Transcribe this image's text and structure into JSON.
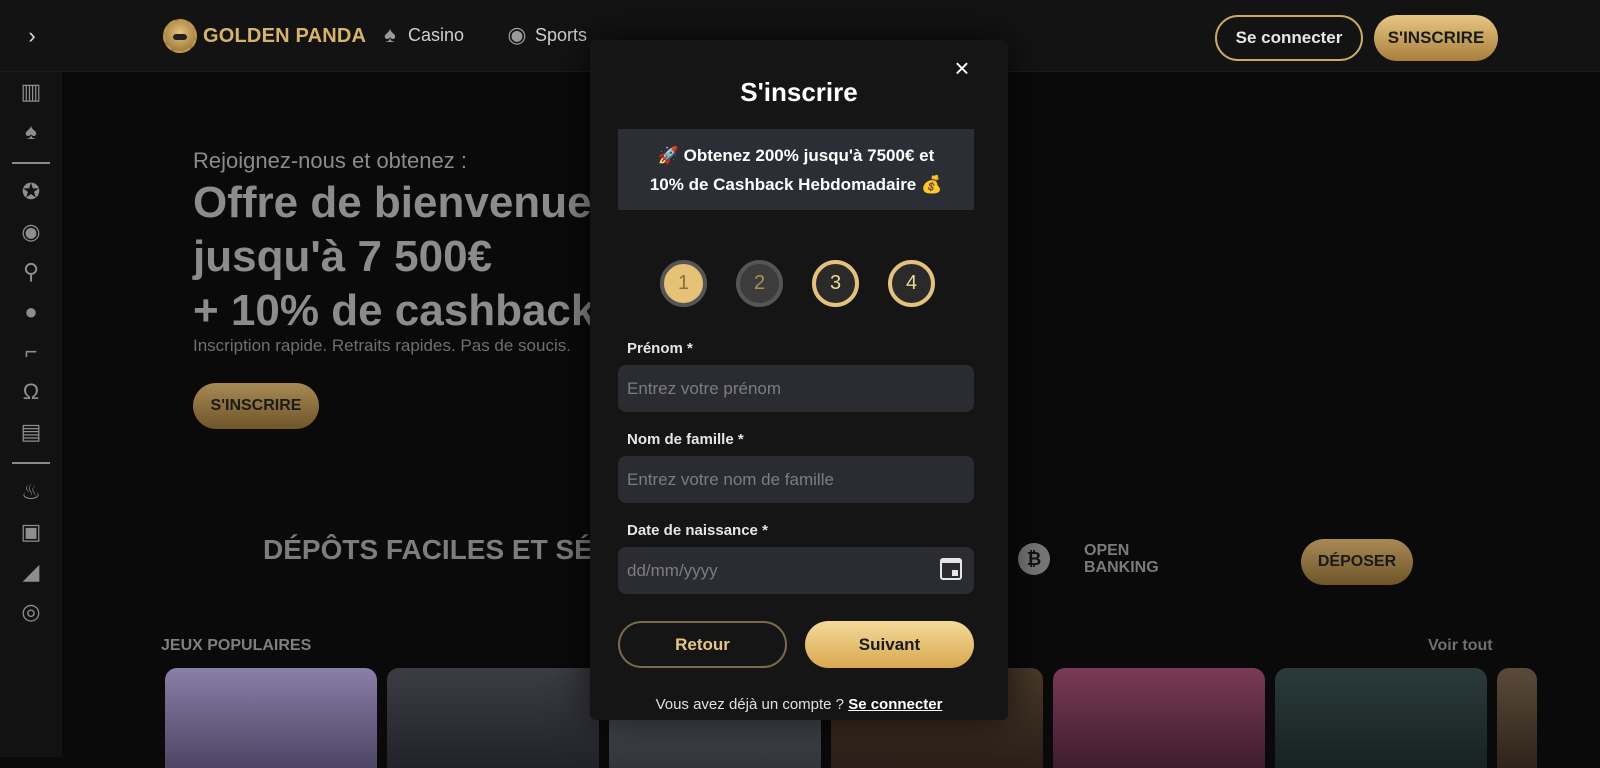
{
  "header": {
    "brand": "GOLDEN PANDA",
    "nav": [
      {
        "label": "Casino",
        "icon": "spade-icon"
      },
      {
        "label": "Sports",
        "icon": "soccer-ball-icon"
      }
    ],
    "login_label": "Se connecter",
    "signup_label": "S'INSCRIRE",
    "expand_icon": "›"
  },
  "sidebar": {
    "icons": [
      "slot-machine-icon",
      "card-icon",
      "star-badge-icon",
      "live-icon",
      "tennis-icon",
      "basketball-icon",
      "hockey-icon",
      "horseshoe-icon",
      "casino-building-icon",
      "fire-icon",
      "gift-icon",
      "megaphone-icon",
      "whistle-icon"
    ]
  },
  "hero": {
    "kicker": "Rejoignez-nous et obtenez :",
    "title_line1": "Offre de bienvenue",
    "title_line2": "jusqu'à 7 500€",
    "title_line3": "+ 10% de cashback",
    "subtitle": "Inscription rapide. Retraits rapides. Pas de soucis.",
    "cta": "S'INSCRIRE"
  },
  "deposit": {
    "title": "DÉPÔTS FACILES ET SÉC",
    "bitcoin_glyph": "₿",
    "open_banking_line1": "OPEN",
    "open_banking_line2": "BANKING",
    "button": "DÉPOSER"
  },
  "games": {
    "label": "JEUX POPULAIRES",
    "see_all": "Voir tout"
  },
  "modal": {
    "title": "S'inscrire",
    "close": "×",
    "promo_line1": "🚀 Obtenez 200% jusqu'à 7500€ et",
    "promo_line2": "10% de Cashback Hebdomadaire 💰",
    "steps": [
      "1",
      "2",
      "3",
      "4"
    ],
    "first_name_label": "Prénom",
    "first_name_placeholder": "Entrez votre prénom",
    "last_name_label": "Nom de famille",
    "last_name_placeholder": "Entrez votre nom de famille",
    "dob_label": "Date de naissance",
    "dob_placeholder": "dd/mm/yyyy",
    "required_mark": "*",
    "back_label": "Retour",
    "next_label": "Suivant",
    "footer_text": "Vous avez déjà un compte ?",
    "footer_link": "Se connecter"
  },
  "colors": {
    "gold": "#e3c27d",
    "background": "#0a0a0a",
    "modal_bg": "#151515",
    "field_bg": "#2b2c32"
  }
}
